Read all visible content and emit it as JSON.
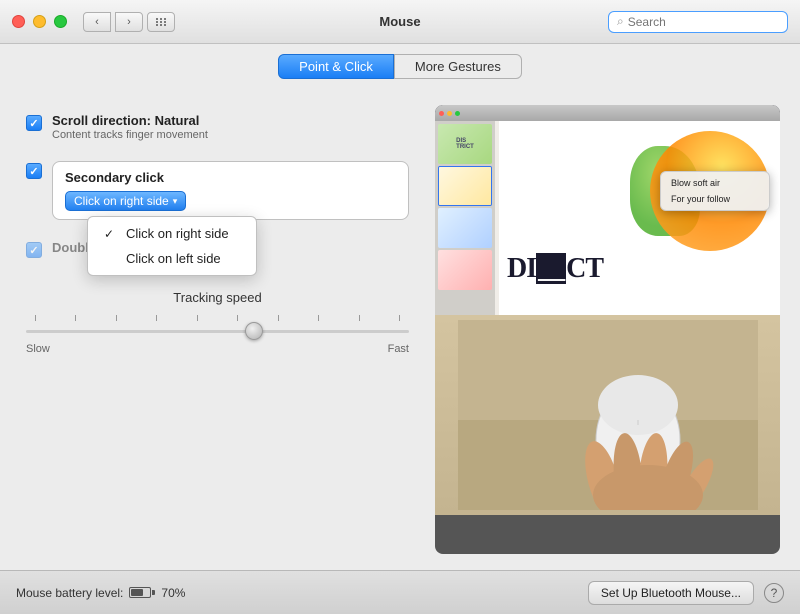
{
  "titlebar": {
    "title": "Mouse",
    "back_label": "‹",
    "forward_label": "›",
    "search_placeholder": "Search"
  },
  "tabs": [
    {
      "id": "point-click",
      "label": "Point & Click",
      "active": true
    },
    {
      "id": "more-gestures",
      "label": "More Gestures",
      "active": false
    }
  ],
  "options": {
    "scroll_direction": {
      "label": "Scroll direction: Natural",
      "description": "Content tracks finger movement",
      "checked": true
    },
    "secondary_click": {
      "label": "Secondary click",
      "checked": true,
      "dropdown": {
        "selected": "Click on right side",
        "items": [
          {
            "label": "Click on right side",
            "checked": true
          },
          {
            "label": "Click on left side",
            "checked": false
          }
        ]
      }
    },
    "double_tap": {
      "label": "Double-tap with one finger",
      "checked": true
    }
  },
  "tracking": {
    "title": "Tracking speed",
    "slow_label": "Slow",
    "fast_label": "Fast",
    "value": 60
  },
  "bottom_bar": {
    "battery_label": "Mouse battery level:",
    "battery_percent": "70%",
    "bluetooth_btn": "Set Up Bluetooth Mouse...",
    "help_label": "?"
  },
  "context_menu": {
    "items": [
      "Blow soft air",
      "For your follow"
    ]
  },
  "slide_text": "DI    CT",
  "icons": {
    "check": "✓",
    "dropdown_arrow": "▾",
    "search": "🔍"
  }
}
